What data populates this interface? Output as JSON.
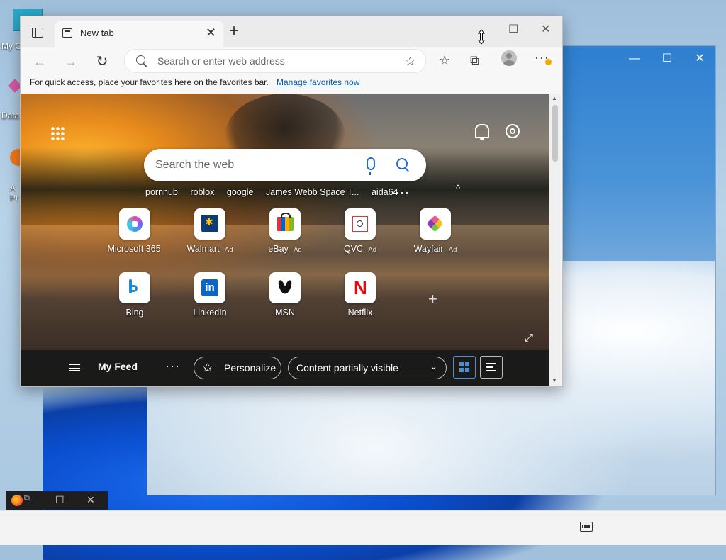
{
  "desktop": {
    "icons": [
      {
        "label": "My C",
        "icon": "computer-icon"
      },
      {
        "label": "Data",
        "icon": "shortcut-icon"
      },
      {
        "label": "A\nPr",
        "icon": "app-icon"
      }
    ]
  },
  "background_window": {
    "controls": {
      "minimize": "—",
      "maximize": "☐",
      "close": "✕"
    }
  },
  "browser": {
    "tab": {
      "title": "New tab",
      "close": "✕"
    },
    "new_tab_label": "+",
    "window_controls": {
      "maximize": "☐",
      "close": "✕"
    },
    "toolbar": {
      "back": "←",
      "forward": "→",
      "refresh": "↻",
      "address_placeholder": "Search or enter web address",
      "add_favorite": "☆",
      "favorites": "☆",
      "collections": "⧉",
      "more": "···"
    },
    "favorites_bar": {
      "text": "For quick access, place your favorites here on the favorites bar.",
      "link": "Manage favorites now"
    }
  },
  "newtab": {
    "search_placeholder": "Search the web",
    "quick_links": [
      "pornhub",
      "roblox",
      "google",
      "James Webb Space T...",
      "aida64"
    ],
    "quick_links_more": "···",
    "collapse": "^",
    "tiles": [
      {
        "label": "Microsoft 365",
        "ad": "",
        "logo": "microsoft-365-logo"
      },
      {
        "label": "Walmart",
        "ad": "· Ad",
        "logo": "walmart-logo"
      },
      {
        "label": "eBay",
        "ad": "· Ad",
        "logo": "ebay-logo"
      },
      {
        "label": "QVC",
        "ad": "· Ad",
        "logo": "qvc-logo"
      },
      {
        "label": "Wayfair",
        "ad": "· Ad",
        "logo": "wayfair-logo"
      },
      {
        "label": "Bing",
        "ad": "",
        "logo": "bing-logo"
      },
      {
        "label": "LinkedIn",
        "ad": "",
        "logo": "linkedin-logo"
      },
      {
        "label": "MSN",
        "ad": "",
        "logo": "msn-logo"
      },
      {
        "label": "Netflix",
        "ad": "",
        "logo": "netflix-logo"
      }
    ],
    "linkedin_glyph": "in",
    "netflix_glyph": "N",
    "add_tile": "+",
    "expand": "⤢",
    "feed": {
      "title": "My Feed",
      "more": "···",
      "personalize": "Personalize",
      "personalize_icon": "✩",
      "content_select": "Content partially visible",
      "chevron": "⌄"
    }
  },
  "scrollbar": {
    "up": "▲",
    "down": "▼"
  }
}
